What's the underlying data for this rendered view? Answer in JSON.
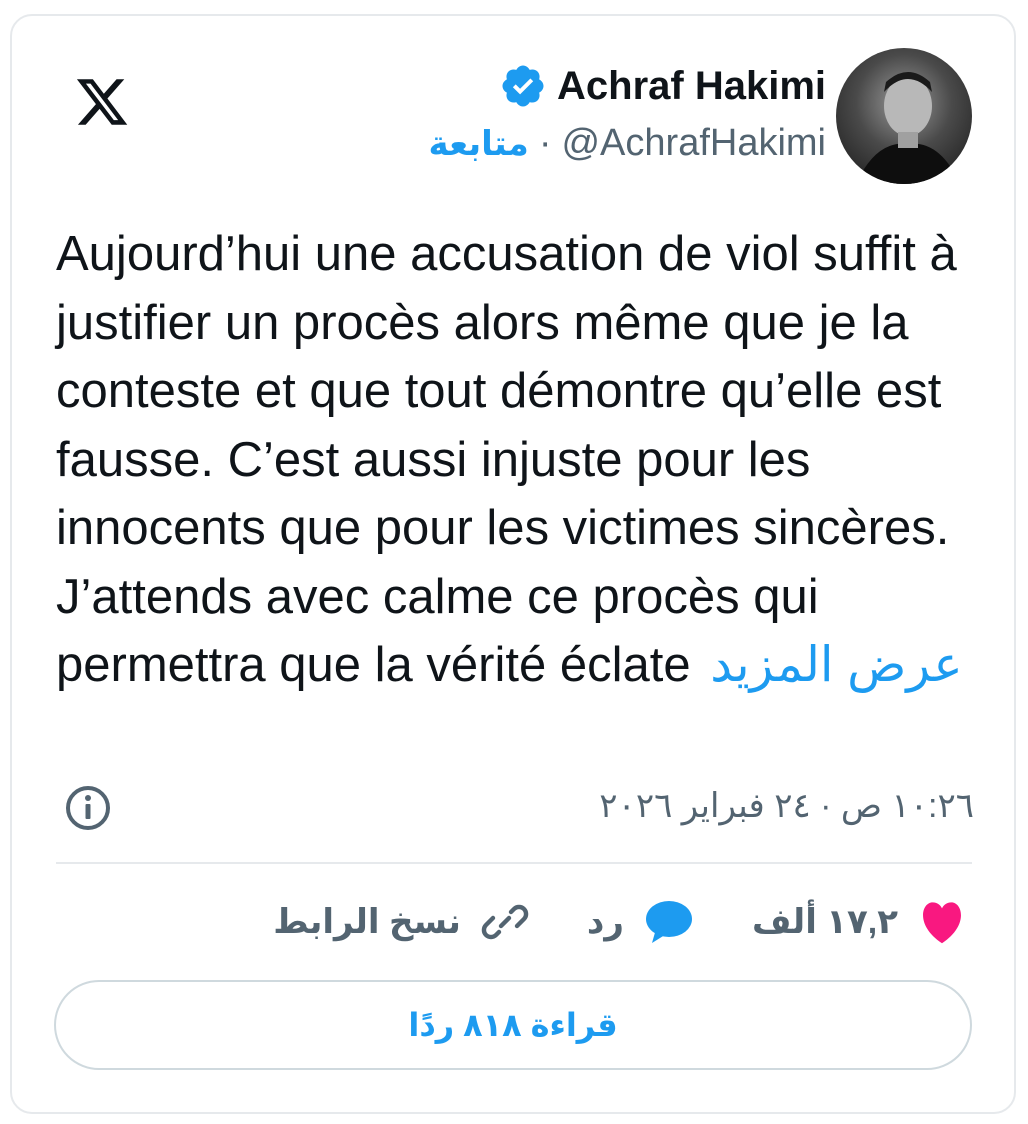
{
  "header": {
    "display_name": "Achraf Hakimi",
    "handle": "@AchrafHakimi",
    "separator": "·",
    "follow_label": "متابعة",
    "verified_color": "#1d9bf0",
    "logo_icon": "x-logo-icon",
    "avatar_icon": "profile-photo"
  },
  "post": {
    "text": "Aujourd’hui une accusation de viol suffit à justifier un procès alors même que je la conteste et que tout démontre qu’elle est fausse. C’est aussi injuste pour les innocents que pour les victimes sincères. J’attends avec calme ce procès qui permettra que la vérité éclate",
    "show_more_label": "عرض المزيد",
    "timestamp": "١٠:٢٦ ص · ٢٤ فبراير ٢٠٢٦"
  },
  "actions": {
    "likes_count": "١٧,٢ ألف",
    "reply_label": "رد",
    "copy_link_label": "نسخ الرابط",
    "like_color": "#f91880",
    "reply_color": "#1d9bf0"
  },
  "replies_button": {
    "label": "قراءة ٨١٨ ردًا"
  },
  "colors": {
    "accent": "#1d9bf0",
    "text_primary": "#0f1419",
    "text_secondary": "#536471",
    "border": "#e6e9ec"
  }
}
